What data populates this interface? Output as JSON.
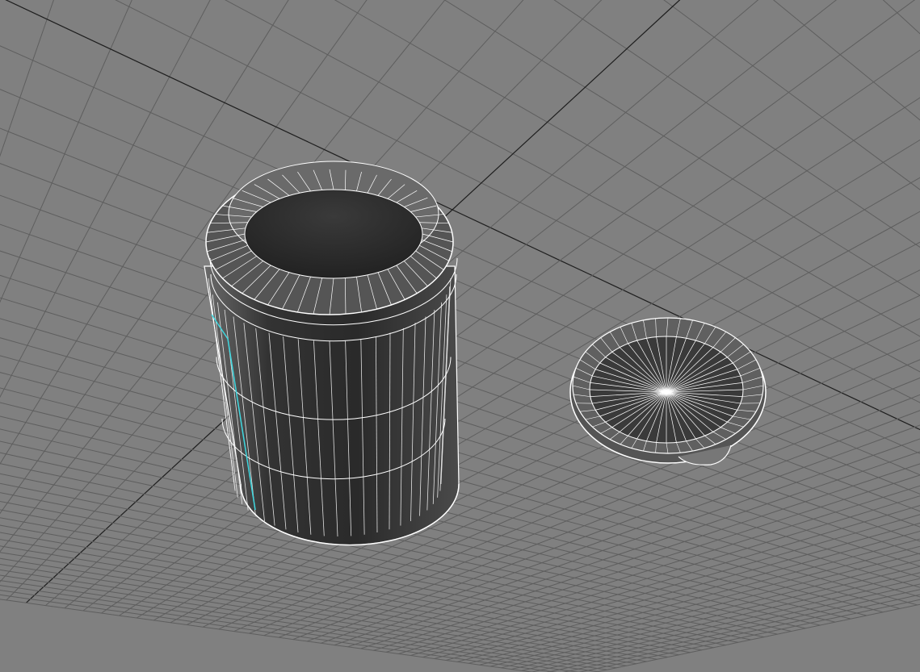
{
  "viewport": {
    "colors": {
      "background": "#808080",
      "grid": "#5e5e5e",
      "axis": "#1e1e1e",
      "wire": "#ffffff",
      "mesh": "#3a3a3a",
      "selection": "#3fd8e0"
    }
  }
}
